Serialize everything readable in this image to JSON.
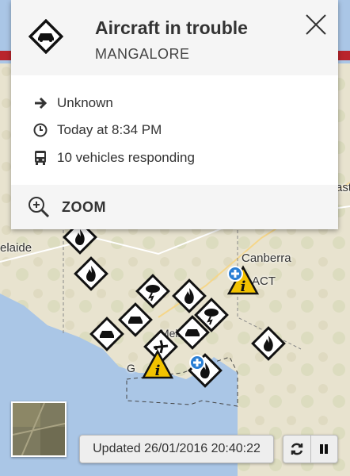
{
  "map": {
    "labels": {
      "adelaide": "elaide",
      "canberra": "Canberra",
      "act": "ACT",
      "melb": "Melb",
      "east": "ast",
      "g": "G"
    }
  },
  "popup": {
    "title": "Aircraft in trouble",
    "location": "MANGALORE",
    "icon": "car-warning-icon",
    "details": {
      "direction": "Unknown",
      "time": "Today at 8:34 PM",
      "vehicles": "10 vehicles responding"
    },
    "zoom_label": "ZOOM"
  },
  "footer": {
    "updated": "Updated 26/01/2016 20:40:22"
  },
  "colors": {
    "header_red": "#b9242c",
    "warning_yellow": "#f2c200",
    "info_blue": "#2a7fd4"
  }
}
